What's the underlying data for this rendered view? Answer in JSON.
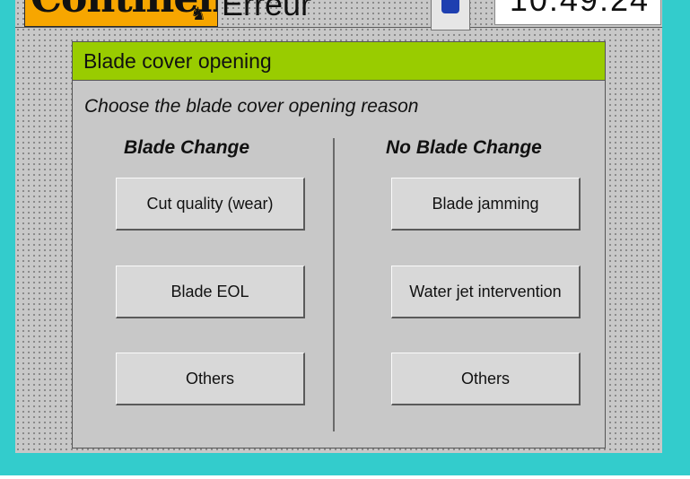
{
  "header": {
    "logo_text": "Continental",
    "status_text": "Erreur",
    "clock": "10:49:24"
  },
  "dialog": {
    "title": "Blade cover opening",
    "prompt": "Choose the blade cover opening reason",
    "blade_change": {
      "heading": "Blade Change",
      "buttons": [
        "Cut quality (wear)",
        "Blade EOL",
        "Others"
      ]
    },
    "no_blade_change": {
      "heading": "No Blade Change",
      "buttons": [
        "Blade jamming",
        "Water jet intervention",
        "Others"
      ]
    }
  },
  "colors": {
    "frame": "#33cccc",
    "title_bar": "#99cc00",
    "logo": "#f7a600",
    "user_icon": "#1e3fb0"
  },
  "icons": {
    "logo": "continental-horse-logo",
    "user": "user-icon"
  }
}
